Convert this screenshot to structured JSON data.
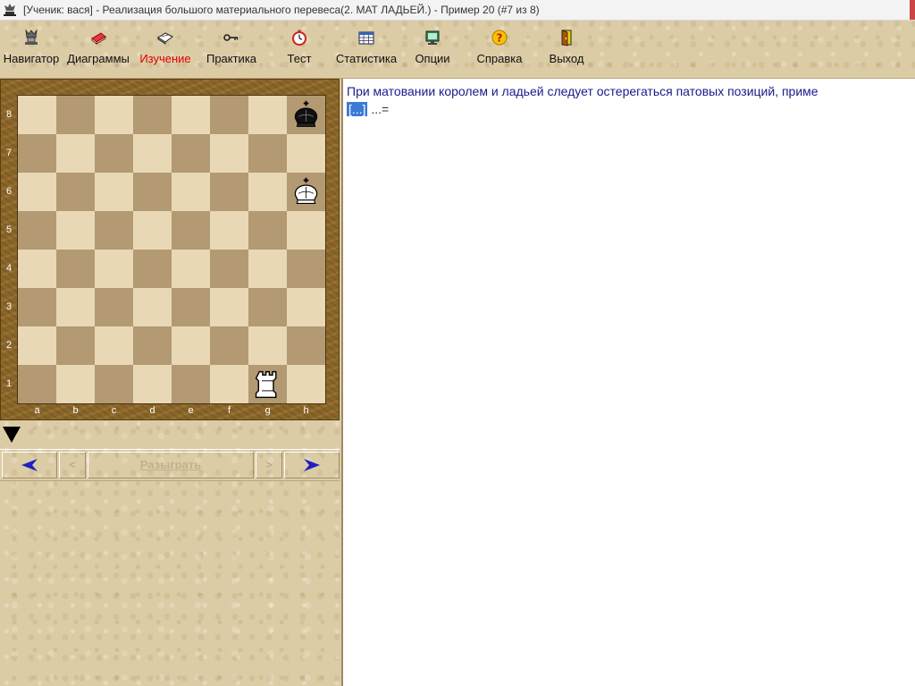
{
  "window": {
    "title": "[Ученик: вася]  - Реализация большого материального перевеса(2. МАТ ЛАДЬЕЙ.) - Пример 20 (#7 из 8)"
  },
  "toolbar": {
    "items": [
      {
        "label": "Навигатор",
        "icon": "navigator-icon"
      },
      {
        "label": "Диаграммы",
        "icon": "diagrams-icon"
      },
      {
        "label": "Изучение",
        "icon": "book-icon",
        "active": true
      },
      {
        "label": "Практика",
        "icon": "key-icon"
      },
      {
        "label": "Тест",
        "icon": "clock-icon"
      },
      {
        "label": "Статистика",
        "icon": "table-icon"
      },
      {
        "label": "Опции",
        "icon": "monitor-icon"
      },
      {
        "label": "Справка",
        "icon": "help-icon"
      },
      {
        "label": "Выход",
        "icon": "exit-door-icon"
      }
    ],
    "active_color": "#e00000"
  },
  "board": {
    "ranks": [
      "8",
      "7",
      "6",
      "5",
      "4",
      "3",
      "2",
      "1"
    ],
    "files": [
      "a",
      "b",
      "c",
      "d",
      "e",
      "f",
      "g",
      "h"
    ],
    "pieces": [
      {
        "square": "h8",
        "piece": "black-king"
      },
      {
        "square": "h6",
        "piece": "white-king"
      },
      {
        "square": "g1",
        "piece": "white-rook"
      }
    ],
    "side_to_move": "black"
  },
  "navigation": {
    "first": "◄",
    "prev": "<",
    "play": "Разыграть",
    "next": ">",
    "last": "►"
  },
  "comment": {
    "text": "При матовании королем и ладьей следует остерегаться патовых позиций, приме",
    "link": "[...]",
    "result": "...="
  },
  "colors": {
    "comment_text": "#1a1a8a",
    "link_highlight": "#3d7ad6",
    "board_light": "#e8d8b6",
    "board_dark": "#b39a72",
    "frame": "#8a6528"
  }
}
